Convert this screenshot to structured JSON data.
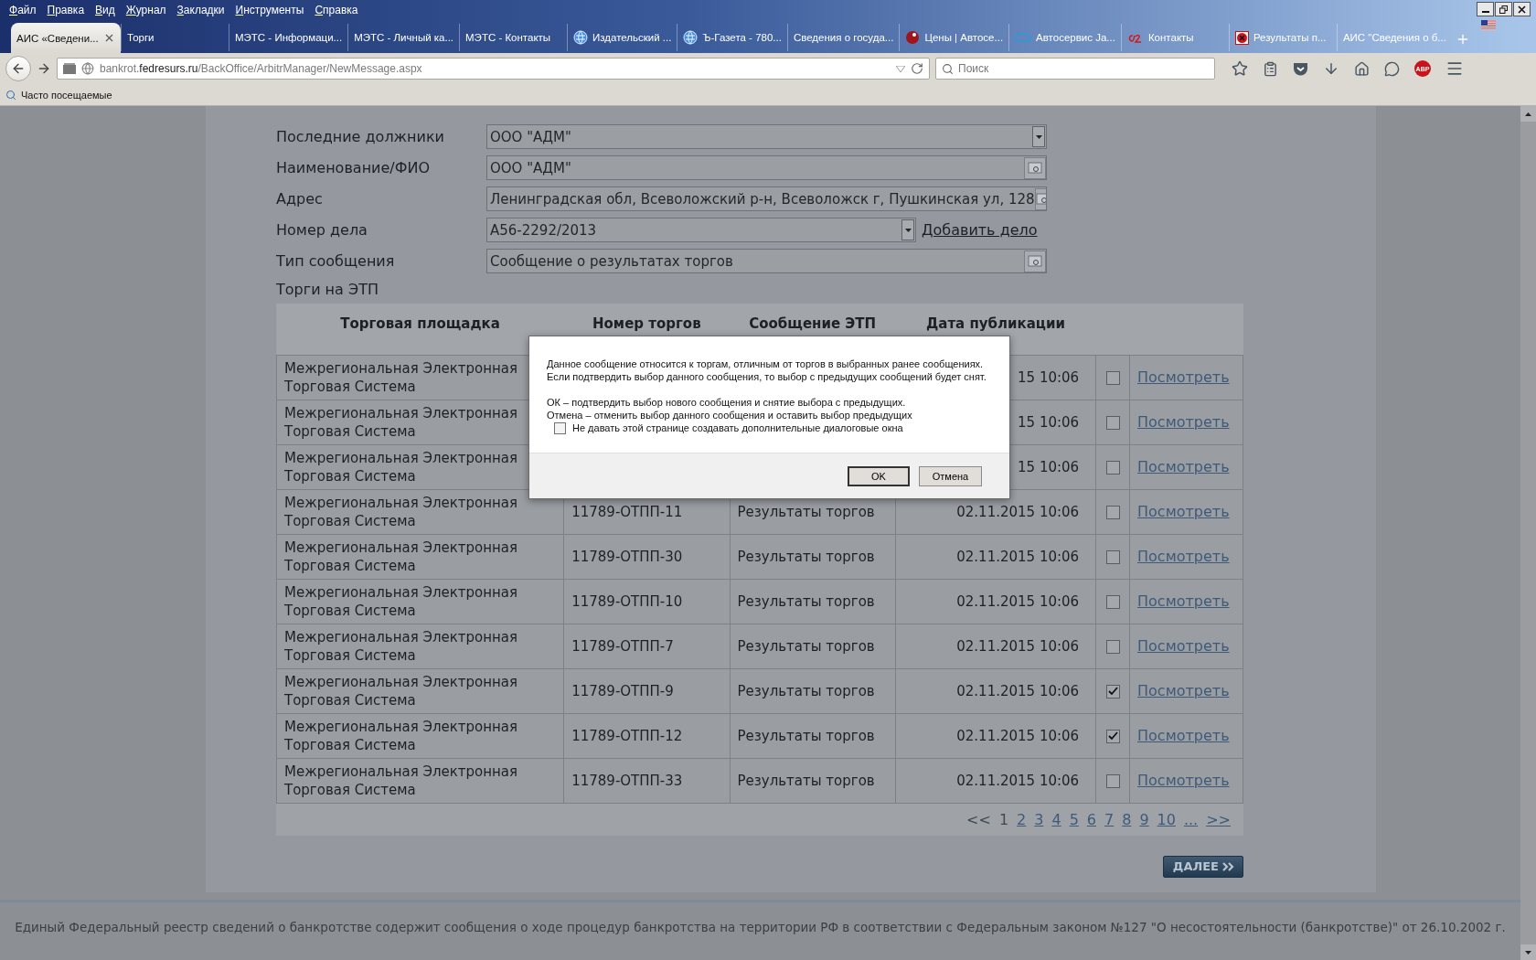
{
  "menu": [
    "Файл",
    "Правка",
    "Вид",
    "Журнал",
    "Закладки",
    "Инструменты",
    "Справка"
  ],
  "tabs": [
    {
      "title": "АИС «Сведени...",
      "selected": true
    },
    {
      "title": "Торги",
      "selected": false
    },
    {
      "title": "МЭТС - Информаци...",
      "selected": false
    },
    {
      "title": "МЭТС - Личный ка...",
      "selected": false
    },
    {
      "title": "МЭТС - Контакты",
      "selected": false
    },
    {
      "title": "Издательский ...",
      "selected": false
    },
    {
      "title": "Ъ-Газета - 780...",
      "selected": false
    },
    {
      "title": "Сведения о госуда...",
      "selected": false
    },
    {
      "title": "Цены | Автосе...",
      "selected": false
    },
    {
      "title": "Автосервис Ja...",
      "selected": false
    },
    {
      "title": "Контакты",
      "selected": false
    },
    {
      "title": "Результаты п...",
      "selected": false
    },
    {
      "title": "АИС \"Сведения о б...",
      "selected": false
    }
  ],
  "address_bar": {
    "subdomain": "bankrot.",
    "domain": "fedresurs.ru",
    "path": "/BackOffice/ArbitrManager/NewMessage.aspx"
  },
  "search": {
    "placeholder": "Поиск"
  },
  "adblock_label": "ABP",
  "bookmarks": [
    "Часто посещаемые"
  ],
  "form": [
    {
      "label": "Последние должники",
      "value": "ООО \"АДМ\"",
      "kind": "select"
    },
    {
      "label": "Наименование/ФИО",
      "value": "ООО \"АДМ\"",
      "kind": "lookup"
    },
    {
      "label": "Адрес",
      "value": "Ленинградская обл, Всеволожский р-н, Всеволожск г, Пушкинская ул, 128",
      "kind": "lookup"
    },
    {
      "label": "Номер дела",
      "value": "А56-2292/2013",
      "kind": "select_link",
      "link": "Добавить дело"
    },
    {
      "label": "Тип сообщения",
      "value": "Сообщение о результатах торгов",
      "kind": "lookup"
    }
  ],
  "section_title": "Торги на ЭТП",
  "table": {
    "columns": [
      "Торговая площадка",
      "Номер торгов",
      "Сообщение ЭТП",
      "Дата публикации"
    ],
    "rows": [
      {
        "platform": "Межрегиональная Электронная Торговая Система",
        "date": "15 10:06",
        "checked": false,
        "link": "Посмотреть"
      },
      {
        "platform": "Межрегиональная Электронная Торговая Система",
        "date": "15 10:06",
        "checked": false,
        "link": "Посмотреть"
      },
      {
        "platform": "Межрегиональная Электронная Торговая Система",
        "date": "15 10:06",
        "checked": false,
        "link": "Посмотреть"
      },
      {
        "platform": "Межрегиональная Электронная Торговая Система",
        "number": "11789-ОТПП-11",
        "message": "Результаты торгов",
        "date": "02.11.2015 10:06",
        "checked": false,
        "link": "Посмотреть"
      },
      {
        "platform": "Межрегиональная Электронная Торговая Система",
        "number": "11789-ОТПП-30",
        "message": "Результаты торгов",
        "date": "02.11.2015 10:06",
        "checked": false,
        "link": "Посмотреть"
      },
      {
        "platform": "Межрегиональная Электронная Торговая Система",
        "number": "11789-ОТПП-10",
        "message": "Результаты торгов",
        "date": "02.11.2015 10:06",
        "checked": false,
        "link": "Посмотреть"
      },
      {
        "platform": "Межрегиональная Электронная Торговая Система",
        "number": "11789-ОТПП-7",
        "message": "Результаты торгов",
        "date": "02.11.2015 10:06",
        "checked": false,
        "link": "Посмотреть"
      },
      {
        "platform": "Межрегиональная Электронная Торговая Система",
        "number": "11789-ОТПП-9",
        "message": "Результаты торгов",
        "date": "02.11.2015 10:06",
        "checked": true,
        "link": "Посмотреть"
      },
      {
        "platform": "Межрегиональная Электронная Торговая Система",
        "number": "11789-ОТПП-12",
        "message": "Результаты торгов",
        "date": "02.11.2015 10:06",
        "checked": true,
        "link": "Посмотреть"
      },
      {
        "platform": "Межрегиональная Электронная Торговая Система",
        "number": "11789-ОТПП-33",
        "message": "Результаты торгов",
        "date": "02.11.2015 10:06",
        "checked": false,
        "link": "Посмотреть"
      }
    ]
  },
  "pagination": [
    {
      "label": "<<",
      "kind": "nav",
      "disabled": true
    },
    {
      "label": "1",
      "kind": "page",
      "selected": true
    },
    {
      "label": "2",
      "kind": "page",
      "selected": false
    },
    {
      "label": "3",
      "kind": "page",
      "selected": false
    },
    {
      "label": "4",
      "kind": "page",
      "selected": false
    },
    {
      "label": "5",
      "kind": "page",
      "selected": false
    },
    {
      "label": "6",
      "kind": "page",
      "selected": false
    },
    {
      "label": "7",
      "kind": "page",
      "selected": false
    },
    {
      "label": "8",
      "kind": "page",
      "selected": false
    },
    {
      "label": "9",
      "kind": "page",
      "selected": false
    },
    {
      "label": "10",
      "kind": "page",
      "selected": false
    },
    {
      "label": "...",
      "kind": "more"
    },
    {
      "label": ">>",
      "kind": "nav",
      "disabled": false
    }
  ],
  "next_button": "ДАЛЕЕ",
  "footer": "Единый Федеральный реестр сведений о банкротстве содержит сообщения о ходе процедур банкротства на территории РФ в соответствии с Федеральным законом №127 \"О несостоятельности (банкротстве)\" от 26.10.2002 г.",
  "dialog": {
    "paragraphs": [
      [
        "Данное сообщение относится к торгам, отличным от торгов в выбранных ранее сообщениях.",
        "Если подтвердить выбор данного сообщения, то выбор с предыдущих сообщений будет снят."
      ],
      [
        "ОК – подтвердить выбор нового сообщения и снятие выбора с предыдущих.",
        "Отмена – отменить выбор данного сообщения и оставить выбор предыдущих"
      ]
    ],
    "checkbox": {
      "label": "Не давать этой странице создавать дополнительные диалоговые окна",
      "checked": false
    },
    "buttons": [
      "OK",
      "Отмена"
    ]
  }
}
